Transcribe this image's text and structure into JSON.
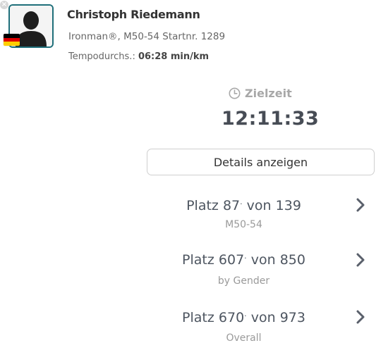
{
  "close_icon_glyph": "×",
  "athlete": {
    "name": "Christoph Riedemann",
    "event_line": "Ironman®, M50-54 Startnr. 1289",
    "pace_label": "Tempodurchs.:",
    "pace_value": "06:28 min/km",
    "flag_colors": [
      "#000000",
      "#dd0000",
      "#ffce00"
    ]
  },
  "result": {
    "target_label": "Zielzeit",
    "target_time": "12:11:33",
    "details_button": "Details anzeigen"
  },
  "rankings": [
    {
      "prefix": "Platz",
      "place": "87",
      "separator": "von",
      "total": "139",
      "category": "M50-54"
    },
    {
      "prefix": "Platz",
      "place": "607",
      "separator": "von",
      "total": "850",
      "category": "by Gender"
    },
    {
      "prefix": "Platz",
      "place": "670",
      "separator": "von",
      "total": "973",
      "category": "Overall"
    }
  ],
  "icons": {
    "close": "close-icon",
    "avatar": "avatar-silhouette",
    "flag": "germany-flag-icon",
    "clock": "clock-icon",
    "chevron": "chevron-right-icon"
  },
  "colors": {
    "avatar_border": "#1f6f7a",
    "text_dark": "#474c55",
    "text_muted": "#9a9a9a",
    "chevron": "#5a606b"
  }
}
